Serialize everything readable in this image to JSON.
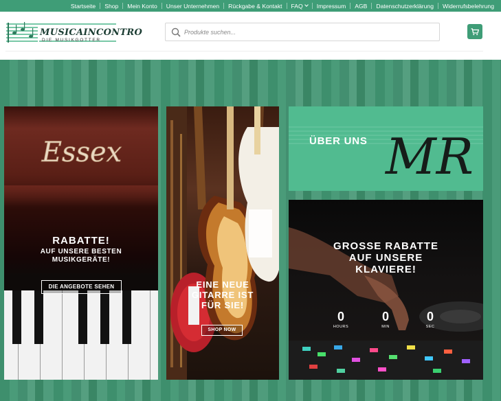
{
  "topnav": [
    "Startseite",
    "Shop",
    "Mein Konto",
    "Unser Unternehmen",
    "Rückgabe & Kontakt",
    "FAQ",
    "Impressum",
    "AGB",
    "Datenschutzerklärung",
    "Widerrufsbelehrung"
  ],
  "logo": {
    "title": "MUSICAINCONTRO",
    "subtitle": "DIE MUSIKGOTTER"
  },
  "search": {
    "placeholder": "Produkte suchen..."
  },
  "colors": {
    "brand_green": "#3f9d77",
    "tile_green": "#51bb90"
  },
  "tiles": {
    "piano": {
      "brand": "Essex",
      "headline": "RABATTE!",
      "subline_1": "AUF UNSERE BESTEN",
      "subline_2": "MUSIKGERÄTE!",
      "button": "DIE ANGEBOTE SEHEN"
    },
    "guitar": {
      "line_1": "EINE NEUE",
      "line_2": "GITARRE IST",
      "line_3": "FÜR SIE!",
      "button": "SHOP NOW"
    },
    "about": {
      "title": "ÜBER UNS",
      "logo_text": "MR"
    },
    "dj": {
      "line_1": "GROSSE RABATTE",
      "line_2": "AUF UNSERE",
      "line_3": "KLAVIERE!",
      "countdown": [
        {
          "value": "0",
          "label": "HOURS"
        },
        {
          "value": "0",
          "label": "MIN"
        },
        {
          "value": "0",
          "label": "SEC"
        }
      ]
    }
  }
}
